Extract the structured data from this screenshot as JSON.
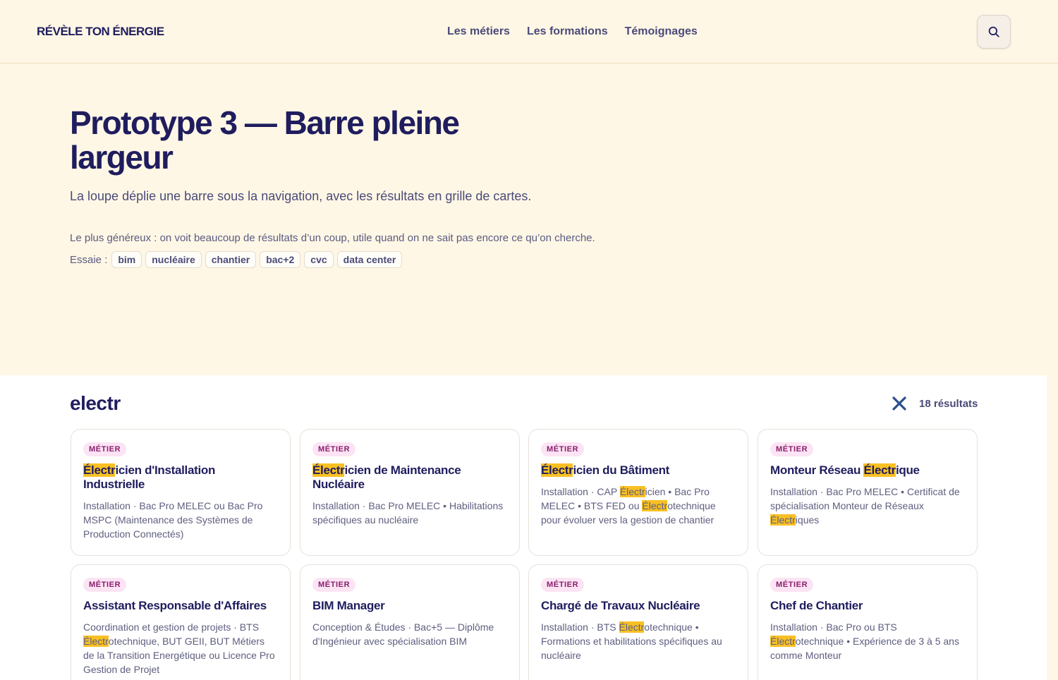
{
  "header": {
    "brand": "RÉVÈLE TON ÉNERGIE",
    "nav": [
      "Les métiers",
      "Les formations",
      "Témoignages"
    ]
  },
  "hero": {
    "title": "Prototype 3 — Barre pleine largeur",
    "lead": "La loupe déplie une barre sous la navigation, avec les résultats en grille de cartes.",
    "desc": "Le plus généreux : on voit beaucoup de résultats d’un coup, utile quand on ne sait pas encore ce qu’on cherche.",
    "try_label": "Essaie :",
    "chips": [
      "bim",
      "nucléaire",
      "chantier",
      "bac+2",
      "cvc",
      "data center"
    ]
  },
  "search": {
    "query": "electr",
    "results_count": "18 résultats"
  },
  "cards": [
    {
      "badge": "MÉTIER",
      "title": [
        {
          "t": "Électr",
          "m": true
        },
        {
          "t": "icien d'Installation Industrielle"
        }
      ],
      "desc": [
        {
          "t": "Installation · Bac Pro MELEC ou Bac Pro MSPC (Maintenance des Systèmes de Production Connectés)"
        }
      ]
    },
    {
      "badge": "MÉTIER",
      "title": [
        {
          "t": "Électr",
          "m": true
        },
        {
          "t": "icien de Maintenance Nucléaire"
        }
      ],
      "desc": [
        {
          "t": "Installation · Bac Pro MELEC • Habilitations spécifiques au nucléaire"
        }
      ]
    },
    {
      "badge": "MÉTIER",
      "title": [
        {
          "t": "Électr",
          "m": true
        },
        {
          "t": "icien du Bâtiment"
        }
      ],
      "desc": [
        {
          "t": "Installation · CAP "
        },
        {
          "t": "Électr",
          "m": true
        },
        {
          "t": "icien • Bac Pro MELEC • BTS FED ou "
        },
        {
          "t": "Électr",
          "m": true
        },
        {
          "t": "otechnique pour évoluer vers la gestion de chantier"
        }
      ]
    },
    {
      "badge": "MÉTIER",
      "title": [
        {
          "t": "Monteur Réseau "
        },
        {
          "t": "Électr",
          "m": true
        },
        {
          "t": "ique"
        }
      ],
      "desc": [
        {
          "t": "Installation · Bac Pro MELEC • Certificat de spécialisation Monteur de Réseaux "
        },
        {
          "t": "Électr",
          "m": true
        },
        {
          "t": "iques"
        }
      ]
    },
    {
      "badge": "MÉTIER",
      "title": [
        {
          "t": "Assistant Responsable d'Affaires"
        }
      ],
      "desc": [
        {
          "t": "Coordination et gestion de projets · BTS "
        },
        {
          "t": "Électr",
          "m": true
        },
        {
          "t": "otechnique, BUT GEII, BUT Métiers de la Transition Energétique ou Licence Pro Gestion de Projet"
        }
      ]
    },
    {
      "badge": "MÉTIER",
      "title": [
        {
          "t": "BIM Manager"
        }
      ],
      "desc": [
        {
          "t": "Conception & Études · Bac+5 — Diplôme d'Ingénieur avec spécialisation BIM"
        }
      ]
    },
    {
      "badge": "MÉTIER",
      "title": [
        {
          "t": "Chargé de Travaux Nucléaire"
        }
      ],
      "desc": [
        {
          "t": "Installation · BTS "
        },
        {
          "t": "Électr",
          "m": true
        },
        {
          "t": "otechnique • Formations et habilitations spécifiques au nucléaire"
        }
      ]
    },
    {
      "badge": "MÉTIER",
      "title": [
        {
          "t": "Chef de Chantier"
        }
      ],
      "desc": [
        {
          "t": "Installation · Bac Pro ou BTS "
        },
        {
          "t": "Électr",
          "m": true
        },
        {
          "t": "otechnique • Expérience de 3 à 5 ans comme Monteur"
        }
      ]
    }
  ],
  "colors": {
    "navy": "#1f1d5e",
    "cream": "#fff7e5",
    "highlight": "#f8c023",
    "badge_bg": "#fce4f4",
    "badge_fg": "#8a1d6d",
    "close": "#2b4f8c"
  }
}
